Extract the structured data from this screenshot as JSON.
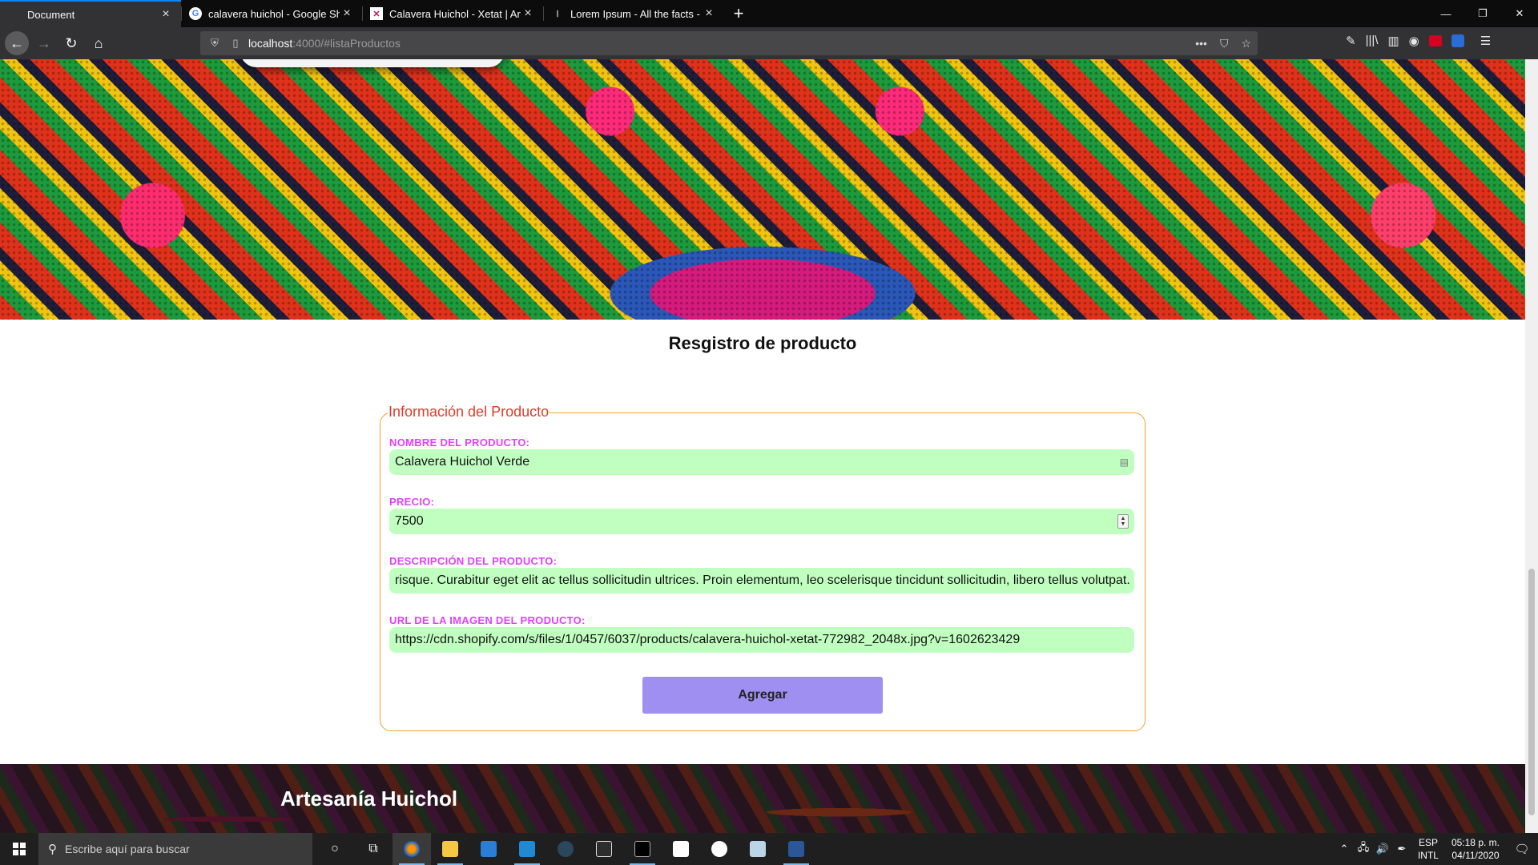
{
  "browser": {
    "tabs": [
      {
        "title": "Document",
        "favicon": "document-icon",
        "active": true
      },
      {
        "title": "calavera huichol - Google Shop",
        "favicon": "google-icon",
        "active": false
      },
      {
        "title": "Calavera Huichol - Xetat | Arte",
        "favicon": "xetat-icon",
        "active": false
      },
      {
        "title": "Lorem Ipsum - All the facts - Li",
        "favicon": "lipsum-icon",
        "active": false
      }
    ],
    "new_tab": "+",
    "window_controls": {
      "minimize": "—",
      "restore": "❐",
      "close": "✕"
    },
    "url": {
      "host": "localhost",
      "path": ":4000/#listaProductos"
    },
    "nav": {
      "back": "←",
      "forward": "→",
      "reload": "↻",
      "home": "⌂"
    },
    "url_actions": {
      "more": "•••",
      "pocket": "⛉",
      "bookmark": "☆"
    },
    "toolbar_icons": {
      "tools": "✎",
      "library": "|||\\",
      "sidebar": "▥",
      "account": "◉",
      "menu": "☰"
    }
  },
  "page": {
    "heading": "Resgistro de producto",
    "form": {
      "legend": "Información del Producto",
      "fields": [
        {
          "label": "NOMBRE DEL PRODUCTO:",
          "value": "Calavera Huichol Verde",
          "type": "text"
        },
        {
          "label": "PRECIO:",
          "value": "7500",
          "type": "number"
        },
        {
          "label": "DESCRIPCIÓN DEL PRODUCTO:",
          "value": "risque. Curabitur eget elit ac tellus sollicitudin ultrices. Proin elementum, leo scelerisque tincidunt sollicitudin, libero tellus volutpat.",
          "type": "text"
        },
        {
          "label": "URL DE LA IMAGEN DEL PRODUCTO:",
          "value": "https://cdn.shopify.com/s/files/1/0457/6037/products/calavera-huichol-xetat-772982_2048x.jpg?v=1602623429",
          "type": "url"
        }
      ],
      "submit_label": "Agregar"
    },
    "footer_title": "Artesanía Huichol"
  },
  "taskbar": {
    "search_placeholder": "Escribe aquí para buscar",
    "apps": [
      "cortana-icon",
      "task-view-icon",
      "firefox-icon",
      "file-explorer-icon",
      "mail-icon",
      "vscode-icon",
      "steam-icon",
      "epic-games-icon",
      "terminal-icon",
      "nodejs-icon",
      "app-icon",
      "paper-icon",
      "word-icon"
    ],
    "language": {
      "top": "ESP",
      "bottom": "INTL"
    },
    "clock": {
      "time": "05:18 p. m.",
      "date": "04/11/2020"
    },
    "tray_chevron": "⌃",
    "notification": "🗨"
  },
  "colors": {
    "label": "#e040fb",
    "input_bg": "#c1ffc1",
    "fieldset_border": "#f0a030",
    "legend": "#e03c2a",
    "button": "#9e8ff0",
    "tab_accent": "#0a84ff"
  }
}
